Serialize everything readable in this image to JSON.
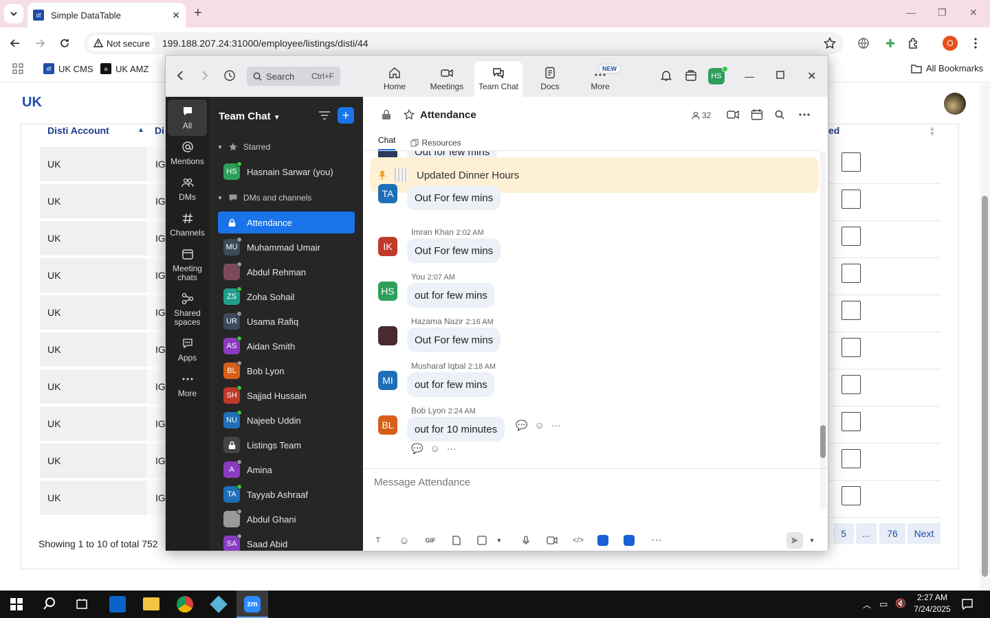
{
  "browser": {
    "tab_title": "Simple DataTable",
    "security_label": "Not secure",
    "url": "199.188.207.24:31000/employee/listings/disti/44",
    "bookmarks": [
      "UK CMS",
      "UK AMZ"
    ],
    "all_bookmarks": "All Bookmarks",
    "profile_initial": "O"
  },
  "table": {
    "col_account": "Disti Account",
    "col_second": "Di",
    "col_last": "ed",
    "rows": [
      "UK",
      "UK",
      "UK",
      "UK",
      "UK",
      "UK",
      "UK",
      "UK",
      "UK",
      "UK"
    ],
    "second_col": "IG",
    "showing": "Showing 1 to 10 of total 752",
    "pages": [
      "5",
      "...",
      "76",
      "Next"
    ]
  },
  "zoom": {
    "search_placeholder": "Search",
    "search_shortcut": "Ctrl+F",
    "tabs": [
      {
        "label": "Home"
      },
      {
        "label": "Meetings"
      },
      {
        "label": "Team Chat"
      },
      {
        "label": "Docs"
      },
      {
        "label": "More"
      }
    ],
    "new_badge": "NEW",
    "user_initials": "HS",
    "rail": [
      {
        "label": "All"
      },
      {
        "label": "Mentions"
      },
      {
        "label": "DMs"
      },
      {
        "label": "Channels"
      },
      {
        "label": "Meeting chats"
      },
      {
        "label": "Shared spaces"
      },
      {
        "label": "Apps"
      },
      {
        "label": "More"
      }
    ],
    "sidebar_title": "Team Chat",
    "starred_label": "Starred",
    "dm_label": "DMs and channels",
    "starred": [
      {
        "initials": "HS",
        "name": "Hasnain Sarwar (you)",
        "color": "#2e9e5b"
      }
    ],
    "channels": [
      {
        "initials": "",
        "name": "Attendance",
        "color": "#1a73e8",
        "active": true
      },
      {
        "initials": "MU",
        "name": "Muhammad Umair",
        "color": "#3c4a5a"
      },
      {
        "initials": "",
        "name": "Abdul Rehman",
        "color": "#7a4a5a"
      },
      {
        "initials": "ZS",
        "name": "Zoha Sohail",
        "color": "#1f9e8c"
      },
      {
        "initials": "UR",
        "name": "Usama Rafiq",
        "color": "#3c4a5a"
      },
      {
        "initials": "AS",
        "name": "Aidan Smith",
        "color": "#8a3cc0"
      },
      {
        "initials": "BL",
        "name": "Bob Lyon",
        "color": "#d6601a"
      },
      {
        "initials": "SH",
        "name": "Sajjad Hussain",
        "color": "#c0392b"
      },
      {
        "initials": "NU",
        "name": "Najeeb Uddin",
        "color": "#1e6fb8"
      },
      {
        "initials": "",
        "name": "Listings Team",
        "color": "#444"
      },
      {
        "initials": "A",
        "name": "Amina",
        "color": "#8a3cc0"
      },
      {
        "initials": "TA",
        "name": "Tayyab Ashraaf",
        "color": "#1e6fb8"
      },
      {
        "initials": "",
        "name": "Abdul Ghani",
        "color": "#999"
      },
      {
        "initials": "SA",
        "name": "Saad Abid",
        "color": "#8a3cc0"
      }
    ],
    "chat": {
      "channel_name": "Attendance",
      "member_count": "32",
      "subtab_chat": "Chat",
      "subtab_resources": "Resources",
      "partial_text": "Out for few mins",
      "pinned": "Updated Dinner Hours",
      "messages": [
        {
          "initials": "TA",
          "color": "#1e6fb8",
          "sender": "",
          "time": "",
          "text": "Out For few mins"
        },
        {
          "initials": "IK",
          "color": "#c0392b",
          "sender": "Imran Khan",
          "time": "2:02 AM",
          "text": "Out For few mins"
        },
        {
          "initials": "HS",
          "color": "#2e9e5b",
          "sender": "You",
          "time": "2:07 AM",
          "text": "out for few mins"
        },
        {
          "initials": "",
          "color": "#4a2a30",
          "sender": "Hazama Nazir",
          "time": "2:16 AM",
          "text": "Out For few mins"
        },
        {
          "initials": "MI",
          "color": "#1e6fb8",
          "sender": "Musharaf Iqbal",
          "time": "2:18 AM",
          "text": "out for few mins"
        },
        {
          "initials": "BL",
          "color": "#d6601a",
          "sender": "Bob Lyon",
          "time": "2:24 AM",
          "text": "out for 10 minutes"
        }
      ],
      "compose_placeholder": "Message Attendance"
    }
  },
  "taskbar": {
    "time": "2:27 AM",
    "date": "7/24/2025"
  }
}
